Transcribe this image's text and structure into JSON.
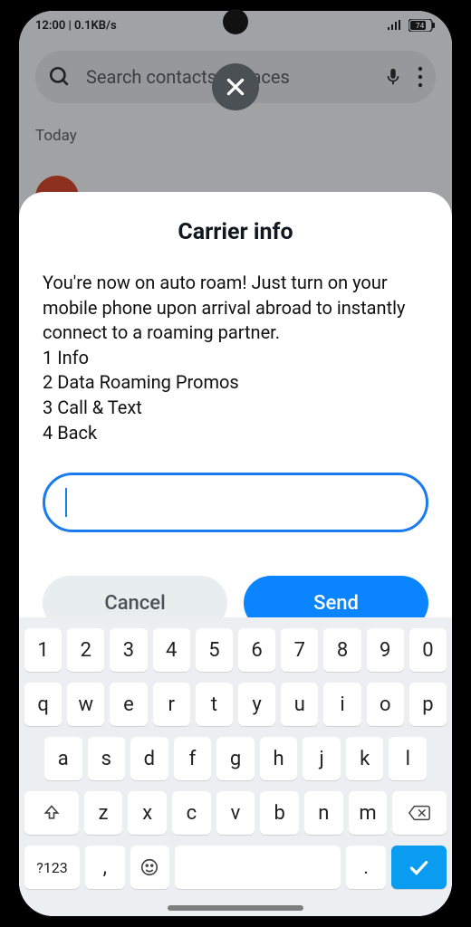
{
  "status": {
    "left": "12:00 | 0.1KB/s",
    "battery": "74"
  },
  "search": {
    "placeholder": "Search contacts & places"
  },
  "today_label": "Today",
  "dialog": {
    "title": "Carrier info",
    "message": "You're now on auto roam! Just turn on your mobile phone upon arrival abroad to instantly connect to a roaming partner.\n1 Info\n2 Data Roaming Promos\n3 Call & Text\n4 Back",
    "cancel": "Cancel",
    "send": "Send"
  },
  "keyboard": {
    "row1": [
      "1",
      "2",
      "3",
      "4",
      "5",
      "6",
      "7",
      "8",
      "9",
      "0"
    ],
    "row2": [
      "q",
      "w",
      "e",
      "r",
      "t",
      "y",
      "u",
      "i",
      "o",
      "p"
    ],
    "row3": [
      "a",
      "s",
      "d",
      "f",
      "g",
      "h",
      "j",
      "k",
      "l"
    ],
    "row4": [
      "z",
      "x",
      "c",
      "v",
      "b",
      "n",
      "m"
    ],
    "sym": "?123",
    "comma": ",",
    "period": "."
  }
}
